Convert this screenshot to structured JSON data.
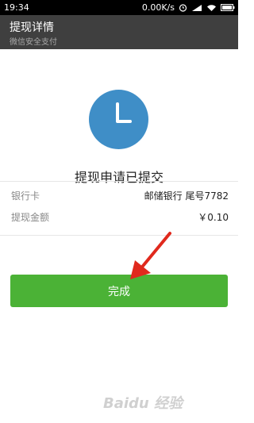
{
  "status_bar": {
    "time": "19:34",
    "net_speed": "0.00K/s",
    "icons": [
      "alarm-icon",
      "signal-icon",
      "wifi-icon",
      "battery-icon"
    ]
  },
  "header": {
    "title": "提现详情",
    "subtitle": "微信安全支付"
  },
  "main": {
    "status_icon": "clock-icon",
    "headline": "提现申请已提交",
    "rows": [
      {
        "label": "银行卡",
        "value": "邮储银行 尾号7782"
      },
      {
        "label": "提现金额",
        "value": "￥0.10"
      }
    ],
    "done_button": "完成"
  },
  "watermark": "Baidu 经验",
  "colors": {
    "status_bar": "#000000",
    "title_bar": "#3f3f3f",
    "clock_circle": "#3f8ec7",
    "button_green": "#4bb236",
    "arrow_red": "#e0291d"
  }
}
